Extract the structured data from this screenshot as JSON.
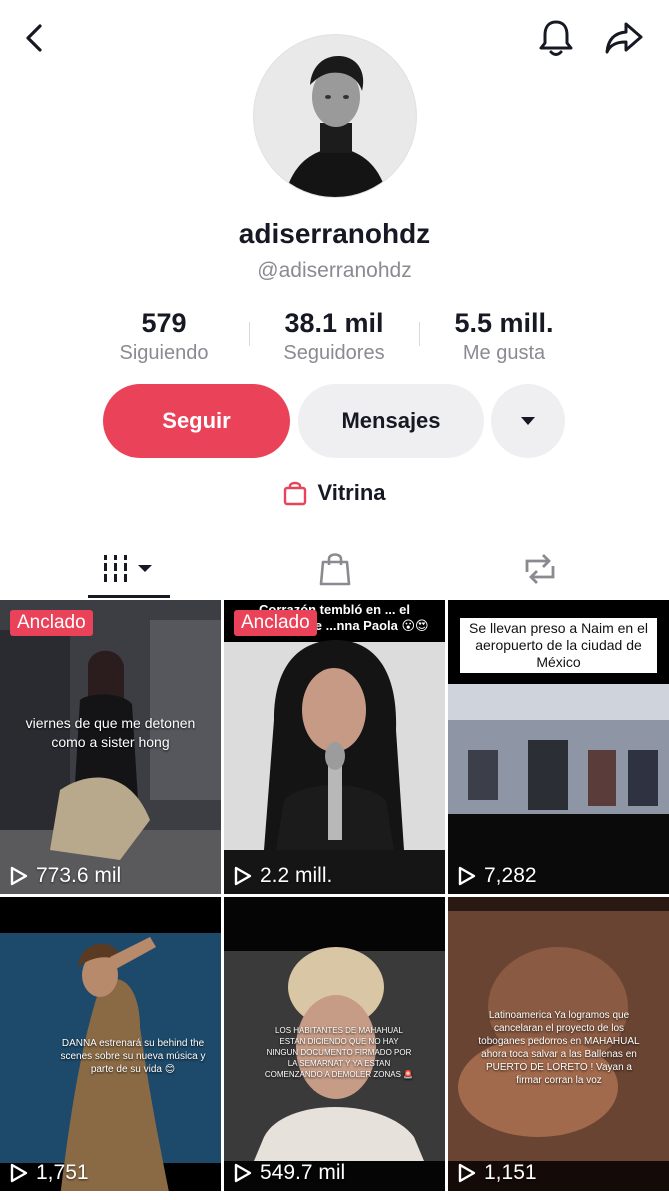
{
  "profile": {
    "display_name": "adiserranohdz",
    "handle": "@adiserranohdz"
  },
  "stats": [
    {
      "value": "579",
      "label": "Siguiendo"
    },
    {
      "value": "38.1 mil",
      "label": "Seguidores"
    },
    {
      "value": "5.5 mill.",
      "label": "Me gusta"
    }
  ],
  "actions": {
    "follow_label": "Seguir",
    "message_label": "Mensajes"
  },
  "showcase_label": "Vitrina",
  "colors": {
    "accent": "#ea4359",
    "text": "#161823",
    "muted": "#8a8b91",
    "button_bg": "#efeff1"
  },
  "videos": [
    {
      "pinned": "Anclado",
      "caption": "viernes de que me detonen como a sister hong",
      "views": "773.6 mil"
    },
    {
      "pinned": "Anclado",
      "caption": "Corrazón tembló en ... el vozarrón que ...nna Paola 😮😍",
      "views": "2.2 mill."
    },
    {
      "caption": "Se llevan preso a  Naim en el aeropuerto de la ciudad de México",
      "views": "7,282"
    },
    {
      "caption": "DANNA estrenará su  behind the scenes sobre su nueva música y parte de su vida 😊",
      "views": "1,751"
    },
    {
      "caption": "LOS HABITANTES DE MAHAHUAL ESTAN DICIENDO QUE NO HAY NINGUN DOCUMENTO FIRMADO POR LA SEMARNAT Y YA ESTAN COMENZANDO A DEMOLER ZONAS 🚨",
      "views": "549.7 mil"
    },
    {
      "caption": "Latinoamerica  Ya logramos que cancelaran el proyecto de los toboganes pedorros en MAHAHUAL ahora toca salvar a las Ballenas en PUERTO DE LORETO  ! Vayan a firmar corran la voz",
      "views": "1,151"
    }
  ]
}
